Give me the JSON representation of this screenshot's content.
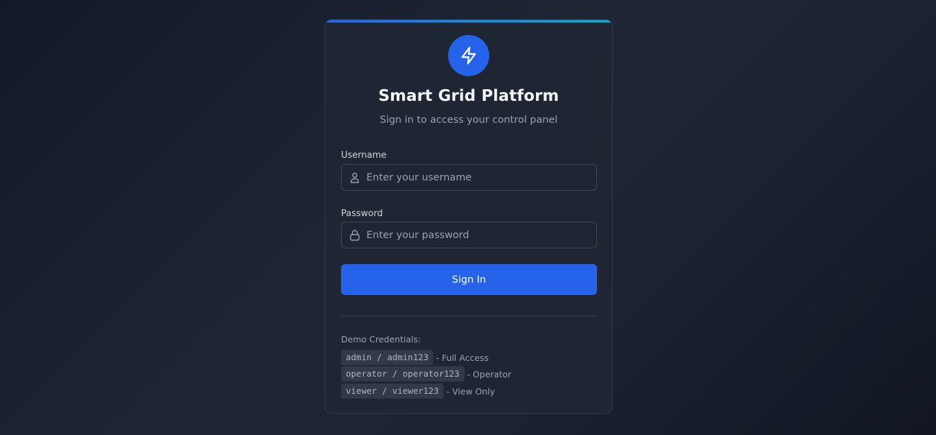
{
  "app": {
    "title": "Smart Grid Platform",
    "subtitle": "Sign in to access your control panel",
    "logo_icon": "lightning-bolt-icon",
    "accent_color": "#2563eb"
  },
  "form": {
    "username": {
      "label": "Username",
      "placeholder": "Enter your username",
      "value": "",
      "icon": "user-icon"
    },
    "password": {
      "label": "Password",
      "placeholder": "Enter your password",
      "value": "",
      "icon": "lock-icon"
    },
    "submit_label": "Sign In"
  },
  "demo": {
    "heading": "Demo Credentials:",
    "credentials": [
      {
        "code": "admin / admin123",
        "desc": "- Full Access"
      },
      {
        "code": "operator / operator123",
        "desc": "- Operator"
      },
      {
        "code": "viewer / viewer123",
        "desc": "- View Only"
      }
    ]
  }
}
